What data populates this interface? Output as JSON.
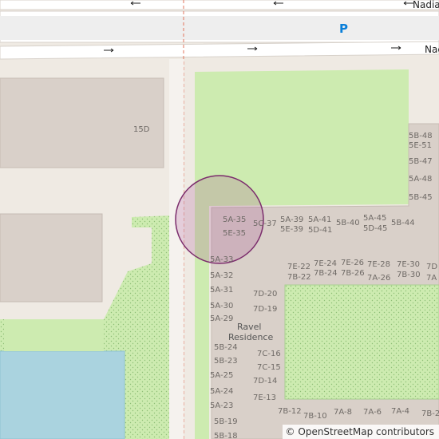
{
  "roads": {
    "north": "Nadia",
    "south": "Nac"
  },
  "parking": "P",
  "place": {
    "line1": "Ravel",
    "line2": "Residence"
  },
  "marker": {
    "label": ""
  },
  "attribution": {
    "prefix": "©",
    "text": "OpenStreetMap contributors"
  },
  "colors": {
    "background": "#efeae3",
    "building": "#d9d0c9",
    "building_stroke": "#c6bcb4",
    "grass": "#cdebb0",
    "water": "#aad3df",
    "road": "#ffffff",
    "marker_fill": "#a23a8a",
    "marker_stroke": "#7b2c6c",
    "parking": "#0a7fd9"
  },
  "building_labels": [
    "15D",
    "5B-48",
    "5E-51",
    "5B-47",
    "5A-48",
    "5B-45",
    "5A-35",
    "5E-35",
    "5C-37",
    "5A-39",
    "5E-39",
    "5A-41",
    "5D-41",
    "5B-40",
    "5A-45",
    "5D-45",
    "5B-44",
    "5A-33",
    "5A-32",
    "5A-31",
    "5A-30",
    "5A-29",
    "5B-24",
    "5B-23",
    "5A-25",
    "5A-24",
    "5A-23",
    "5B-19",
    "5B-18",
    "7E-22",
    "7B-22",
    "7E-24",
    "7B-24",
    "7E-26",
    "7B-26",
    "7E-28",
    "7A-26",
    "7E-30",
    "7B-30",
    "7D",
    "7A",
    "7D-20",
    "7D-19",
    "7C-16",
    "7C-15",
    "7D-14",
    "7E-13",
    "7B-12",
    "7B-10",
    "7A-8",
    "7A-6",
    "7A-4",
    "7B-2"
  ]
}
